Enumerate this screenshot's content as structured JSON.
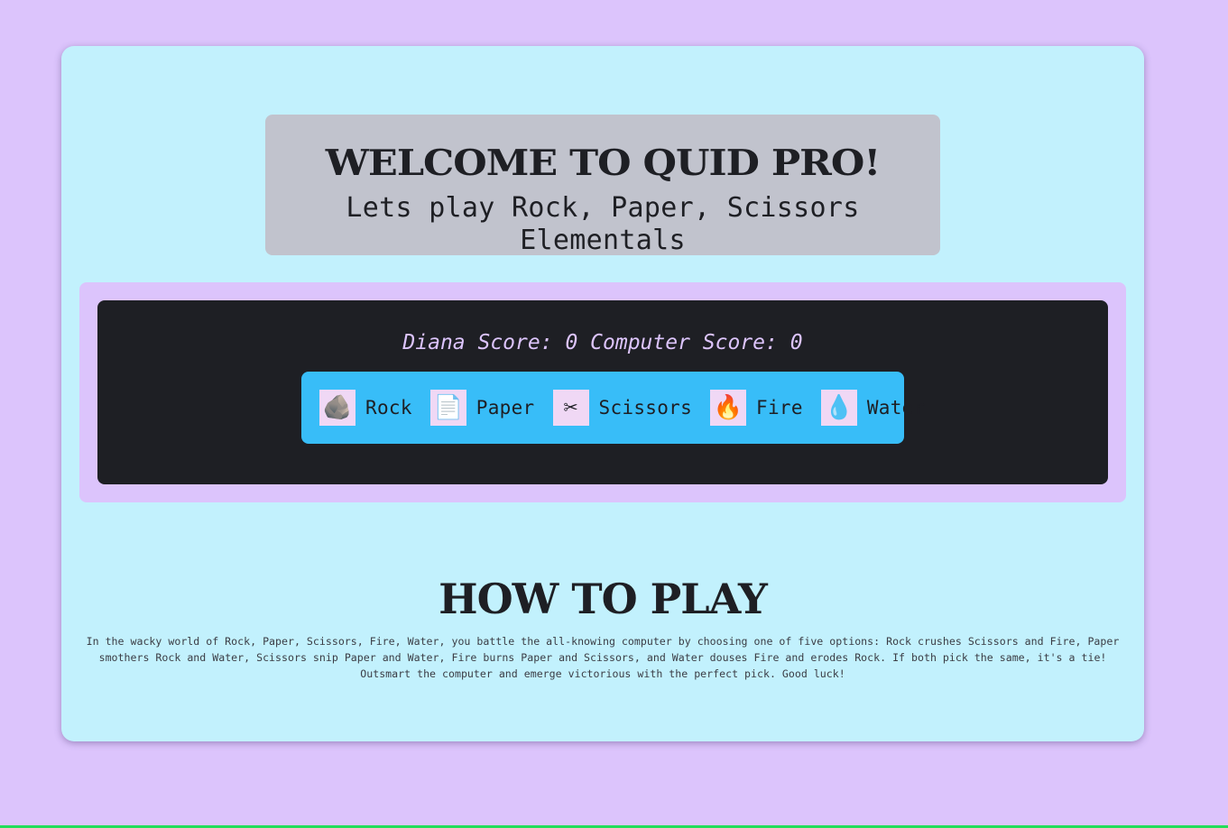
{
  "header": {
    "title": "WELCOME TO QUID PRO!",
    "subtitle": "Lets play Rock, Paper, Scissors Elementals"
  },
  "scoreboard": {
    "player_label": "Diana Score:",
    "player_score": "0",
    "computer_label": "Computer Score:",
    "computer_score": "0"
  },
  "choices": [
    {
      "label": "Rock",
      "icon": "rock-icon",
      "glyph": "🪨"
    },
    {
      "label": "Paper",
      "icon": "paper-icon",
      "glyph": "📄"
    },
    {
      "label": "Scissors",
      "icon": "scissors-icon",
      "glyph": "✂"
    },
    {
      "label": "Fire",
      "icon": "fire-icon",
      "glyph": "🔥"
    },
    {
      "label": "Water",
      "icon": "water-icon",
      "glyph": "💧"
    }
  ],
  "how_to_play": {
    "title": "HOW TO PLAY",
    "text": "In the wacky world of Rock, Paper, Scissors, Fire, Water, you battle the all-knowing computer by choosing one of five options: Rock crushes Scissors and Fire, Paper smothers Rock and Water, Scissors snip Paper and Water, Fire burns Paper and Scissors, and Water douses Fire and erodes Rock. If both pick the same, it's a tie! Outsmart the computer and emerge victorious with the perfect pick. Good luck!"
  },
  "colors": {
    "page_background": "#dcc4fc",
    "card_background": "#c2f1fd",
    "header_box": "#c1c3cd",
    "game_panel": "#1e1f24",
    "choices_bar": "#38bdf8",
    "score_text": "#dcc4fc",
    "accent_line": "#22dd5a"
  }
}
